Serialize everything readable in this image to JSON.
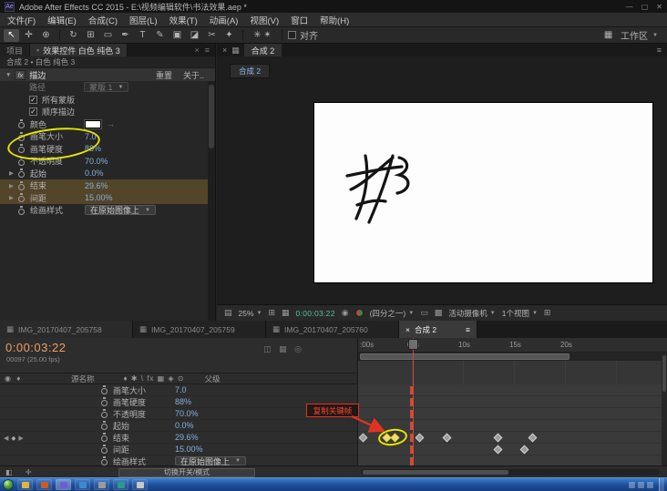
{
  "titlebar": {
    "badge": "Ae",
    "title": "Adobe After Effects CC 2015 - E:\\视频编辑软件\\书法效果.aep *"
  },
  "menu": {
    "items": [
      "文件(F)",
      "编辑(E)",
      "合成(C)",
      "图层(L)",
      "效果(T)",
      "动画(A)",
      "视图(V)",
      "窗口",
      "帮助(H)"
    ]
  },
  "toolbar": {
    "align": "对齐",
    "workspace": "工作区",
    "tools": [
      {
        "name": "selection",
        "glyph": "↖"
      },
      {
        "name": "hand",
        "glyph": "✛"
      },
      {
        "name": "zoom",
        "glyph": "⊕"
      },
      {
        "name": "orbit-camera",
        "glyph": "↻"
      },
      {
        "name": "pan-behind",
        "glyph": "⊞"
      },
      {
        "name": "mask-shape",
        "glyph": "▭"
      },
      {
        "name": "pen",
        "glyph": "✒"
      },
      {
        "name": "text",
        "glyph": "T"
      },
      {
        "name": "brush",
        "glyph": "✎"
      },
      {
        "name": "clone-stamp",
        "glyph": "▣"
      },
      {
        "name": "eraser",
        "glyph": "◪"
      },
      {
        "name": "roto-brush",
        "glyph": "✂"
      },
      {
        "name": "puppet-pin",
        "glyph": "✦"
      }
    ],
    "axis_glyphs": "✳ ✴"
  },
  "effect_controls": {
    "tab_project": "项目",
    "tab_title": "效果控件 白色 纯色 3",
    "breadcrumb": "合成 2 • 白色 纯色 3",
    "header": {
      "fx": "fx",
      "name": "描边",
      "reset": "重置",
      "about": "关于.."
    },
    "path": {
      "label": "路径",
      "value": "蒙版 1"
    },
    "checks": [
      {
        "label": "所有蒙版"
      },
      {
        "label": "顺序描边"
      }
    ],
    "color_label": "颜色",
    "params": [
      {
        "label": "画笔大小",
        "value": "7.0"
      },
      {
        "label": "画笔硬度",
        "value": "88%"
      },
      {
        "label": "不透明度",
        "value": "70.0%"
      },
      {
        "label": "起始",
        "value": "0.0%"
      },
      {
        "label": "结束",
        "value": "29.6%"
      },
      {
        "label": "间距",
        "value": "15.00%"
      },
      {
        "label": "绘画样式",
        "value": "在原始图像上"
      }
    ]
  },
  "viewer": {
    "tab_label": "合成 2",
    "nav_chip": "合成 2",
    "zoom": "25%",
    "timecode": "0:00:03:22",
    "resolution": "(四分之一)",
    "camera": "活动摄像机",
    "views": "1个视图"
  },
  "timeline": {
    "tabs": [
      "IMG_20170407_205758",
      "IMG_20170407_205759",
      "IMG_20170407_205760",
      "合成 2"
    ],
    "timecode": "0:00:03:22",
    "frame_info": "00097 (25.00 fps)",
    "col_source": "源名称",
    "col_parent": "父级",
    "rows": [
      {
        "label": "画笔大小",
        "value": "7.0"
      },
      {
        "label": "画笔硬度",
        "value": "88%"
      },
      {
        "label": "不透明度",
        "value": "70.0%"
      },
      {
        "label": "起始",
        "value": "0.0%"
      },
      {
        "label": "结束",
        "value": "29.6%"
      },
      {
        "label": "间距",
        "value": "15.00%"
      },
      {
        "label": "绘画样式",
        "value": "在原始图像上"
      }
    ],
    "ruler": [
      ":00s",
      "05s",
      "10s",
      "15s",
      "20s"
    ],
    "annotation": "复制关键帧",
    "toggle": "切换开关/模式"
  },
  "icons": {
    "close": "×",
    "menu": "≡",
    "dropdown": "▼",
    "twirl": "▼",
    "expander": "▶",
    "check": "✓",
    "kf_prev": "◀",
    "kf_diamond": "◆",
    "kf_next": "▶",
    "tab_icon": "▦",
    "lock": "▪",
    "grid": "⊞",
    "safe_zones": "▦",
    "snapshot": "◉",
    "roi": "▭",
    "transparency": "▩",
    "layout_left": "▤",
    "minimize": "—",
    "maximize": "▢",
    "close_win": "✕",
    "eyedrop_arrow": "→",
    "hash": "#"
  },
  "glyph_clusters": {
    "tl_header": "◫ ▦ ◎",
    "tl_switches": "♦ ✱ \\ fx ▦ ◈ ⊙",
    "col_left": "◉ ♦",
    "appbar_left": "◧ ✛"
  },
  "colors": {
    "value_blue": "#86aede",
    "timecode_orange": "#ef9d5e",
    "viewer_timecode_teal": "#5cbfa0",
    "annotation_red": "#e23222",
    "circle_yellow": "#e8e400",
    "taskbar_blue": "#2a62b8"
  }
}
